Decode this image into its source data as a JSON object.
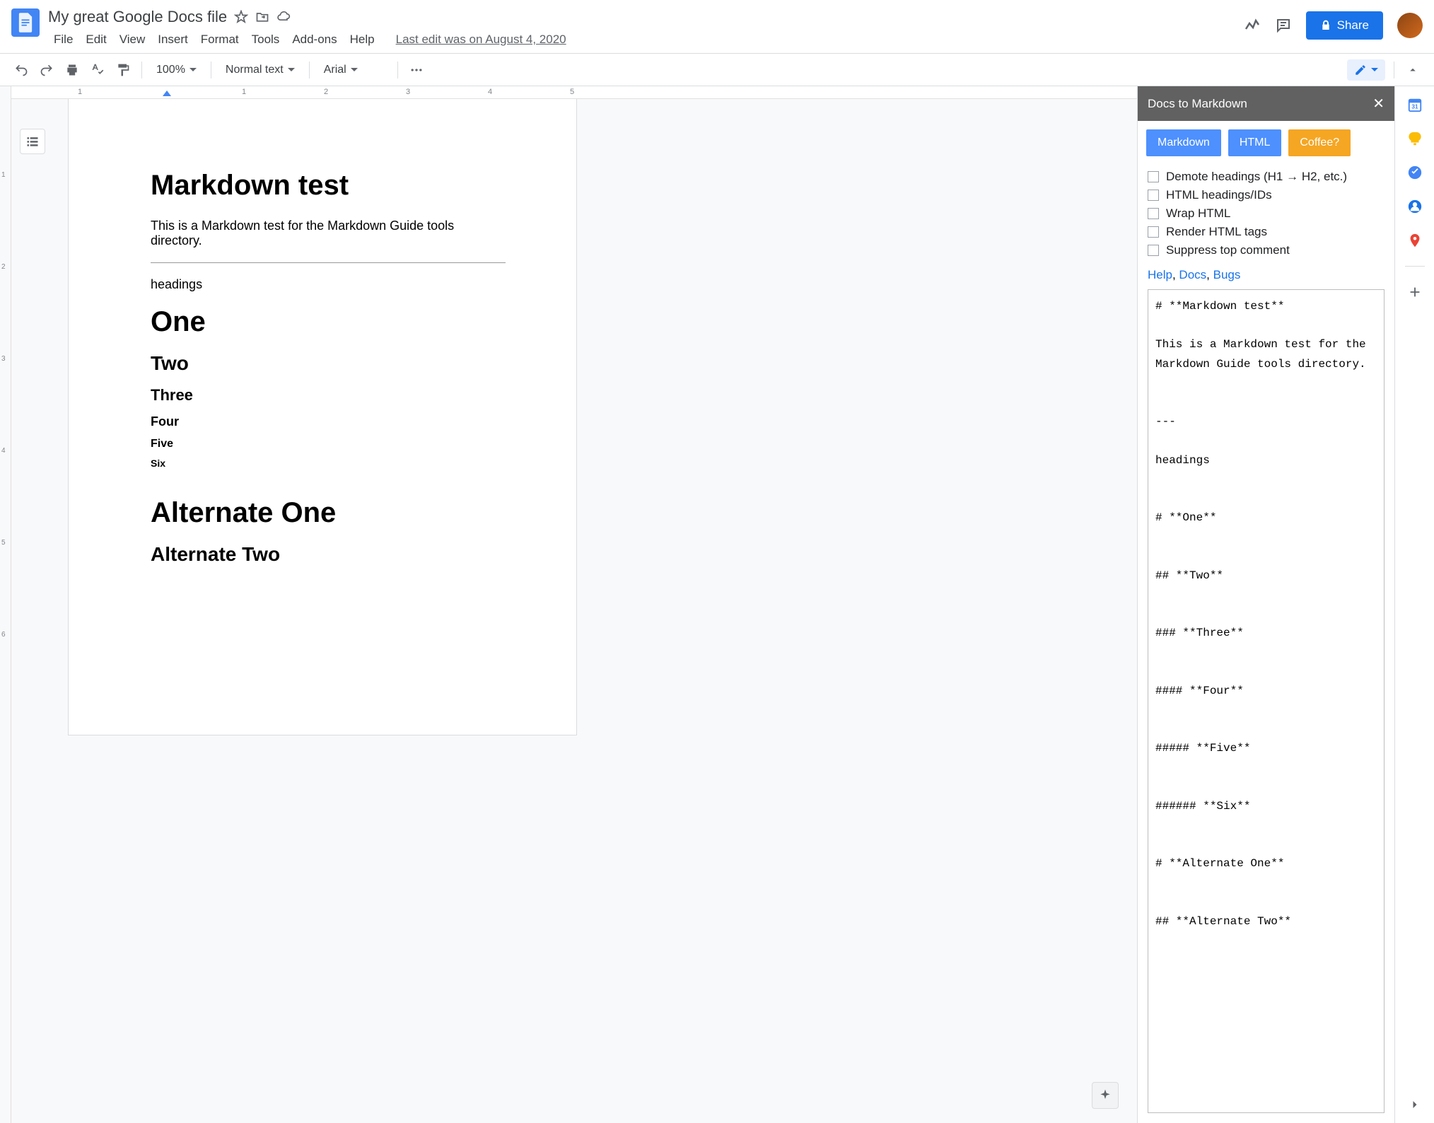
{
  "header": {
    "doc_title": "My great Google Docs file",
    "menus": [
      "File",
      "Edit",
      "View",
      "Insert",
      "Format",
      "Tools",
      "Add-ons",
      "Help"
    ],
    "last_edit": "Last edit was on August 4, 2020",
    "share_label": "Share"
  },
  "toolbar": {
    "zoom": "100%",
    "style": "Normal text",
    "font": "Arial"
  },
  "ruler_h": [
    "1",
    "2",
    "3",
    "4",
    "5"
  ],
  "ruler_v": [
    "1",
    "2",
    "3",
    "4",
    "5",
    "6"
  ],
  "document": {
    "title": "Markdown test",
    "intro": "This is a Markdown test for the Markdown Guide tools directory.",
    "section_label": "headings",
    "h1": "One",
    "h2": "Two",
    "h3": "Three",
    "h4": "Four",
    "h5": "Five",
    "h6": "Six",
    "alt1": "Alternate One",
    "alt2": "Alternate Two"
  },
  "addon": {
    "title": "Docs to Markdown",
    "tabs": {
      "markdown": "Markdown",
      "html": "HTML",
      "coffee": "Coffee?"
    },
    "options": [
      "Demote headings (H1 → H2, etc.)",
      "HTML headings/IDs",
      "Wrap HTML",
      "Render HTML tags",
      "Suppress top comment"
    ],
    "links": {
      "help": "Help",
      "docs": "Docs",
      "bugs": "Bugs"
    },
    "output": "# **Markdown test**\n\nThis is a Markdown test for the Markdown Guide tools directory.\n\n\n---\n\nheadings\n\n\n# **One**\n\n\n## **Two**\n\n\n### **Three**\n\n\n#### **Four**\n\n\n##### **Five**\n\n\n###### **Six**\n\n\n# **Alternate One**\n\n\n## **Alternate Two**"
  }
}
